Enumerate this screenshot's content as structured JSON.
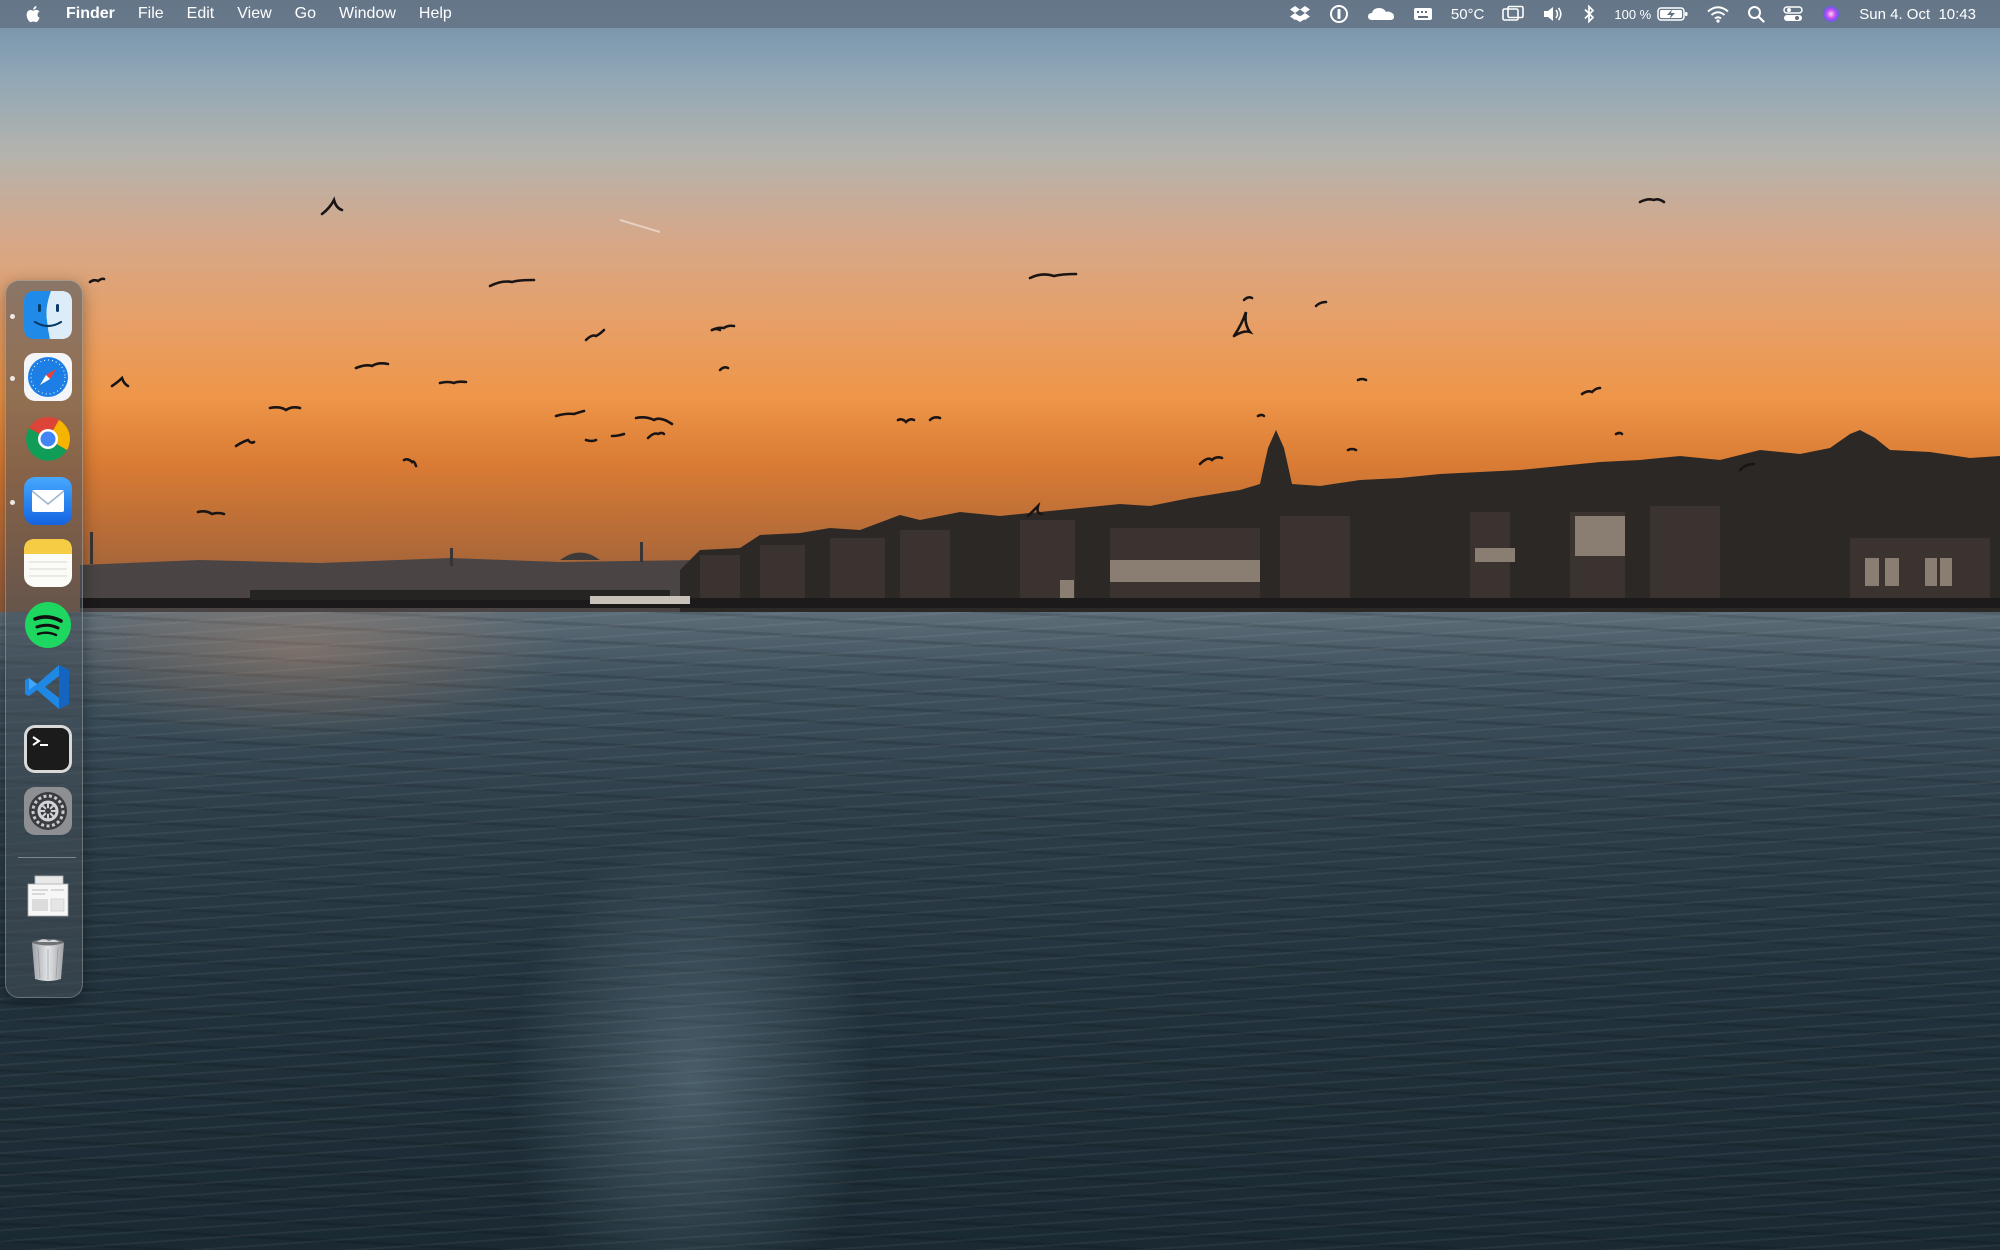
{
  "menubar": {
    "app_name": "Finder",
    "menus": [
      "File",
      "Edit",
      "View",
      "Go",
      "Window",
      "Help"
    ],
    "status": {
      "temperature": "50°C",
      "battery": "100 %",
      "datetime": "Sun 4. Oct  10:43"
    },
    "status_icons": [
      "dropbox-icon",
      "1password-icon",
      "cloudflare-icon",
      "keyboard-icon",
      "temperature",
      "display-icon",
      "volume-icon",
      "bluetooth-icon",
      "battery",
      "wifi-icon",
      "spotlight-icon",
      "control-center-icon",
      "siri-icon",
      "datetime"
    ]
  },
  "dock": {
    "items": [
      {
        "name": "Finder",
        "icon": "finder-icon",
        "running": true
      },
      {
        "name": "Safari",
        "icon": "safari-icon",
        "running": true
      },
      {
        "name": "Google Chrome",
        "icon": "chrome-icon",
        "running": false
      },
      {
        "name": "Mail",
        "icon": "mail-icon",
        "running": true
      },
      {
        "name": "Notes",
        "icon": "notes-icon",
        "running": false
      },
      {
        "name": "Spotify",
        "icon": "spotify-icon",
        "running": false
      },
      {
        "name": "Visual Studio Code",
        "icon": "vscode-icon",
        "running": false
      },
      {
        "name": "Terminal",
        "icon": "terminal-icon",
        "running": false
      },
      {
        "name": "System Preferences",
        "icon": "system-preferences-icon",
        "running": false
      }
    ],
    "extras": [
      {
        "name": "Downloads",
        "icon": "downloads-stack-icon"
      },
      {
        "name": "Trash",
        "icon": "trash-icon"
      }
    ]
  },
  "desktop": {
    "wallpaper": "istanbul-sunset-bosphorus"
  },
  "colors": {
    "menubar": "#5f6e7d",
    "sky_top": "#6f8ca6",
    "sky_horizon": "#ee9649",
    "sea": "#22323c"
  }
}
